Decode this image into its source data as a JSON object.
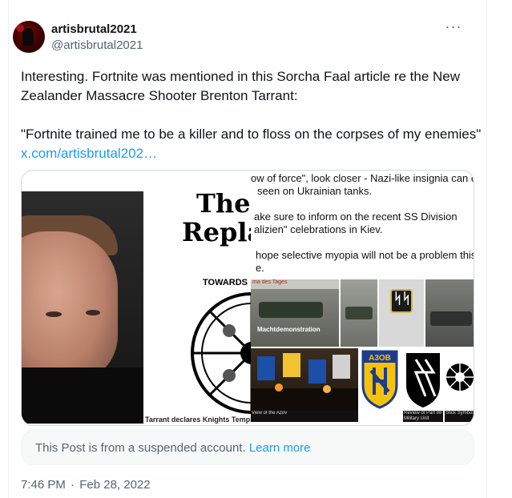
{
  "author": {
    "display_name": "artisbrutal2021",
    "handle": "@artisbrutal2021"
  },
  "more_icon": "ellipsis-icon",
  "tweet": {
    "line1": "Interesting. Fortnite was mentioned in this Sorcha Faal article re the New Zealander Massacre Shooter Brenton Tarrant:",
    "line2": "\"Fortnite trained me to be a killer and to floss on the corpses of my enemies\"",
    "link_text": "x.com/artisbrutal202…"
  },
  "media": {
    "poster_title_1": "The",
    "poster_title_2": "Repla",
    "poster_towards": "TOWARDS",
    "poster_caption": "Tarrant declares Knights Templar sanctioned his New Zealand",
    "snippet_lines": [
      "ow of force\", look closer - Nazi-like insignia can o",
      "seen on Ukrainian tanks.",
      "ake sure to inform on the recent SS Division",
      "alizien\" celebrations in Kiev.",
      "hope selective myopia will not be a problem this",
      "e."
    ],
    "tile_header": "ma des Tages",
    "tile_title": "Machtdemonstration",
    "azov_text": "A3OB",
    "captions": [
      "View of the Azov",
      "Review of Part 88 Military Unit",
      "Stick Symbol"
    ]
  },
  "notice": {
    "text": "This Post is from a suspended account.",
    "link": "Learn more"
  },
  "timestamp": {
    "time": "7:46 PM",
    "separator": "·",
    "date": "Feb 28, 2022"
  },
  "colors": {
    "link_blue": "#1d9bf0",
    "secondary_text": "#536471",
    "primary_text": "#0f1419",
    "border": "#cfd9de"
  }
}
